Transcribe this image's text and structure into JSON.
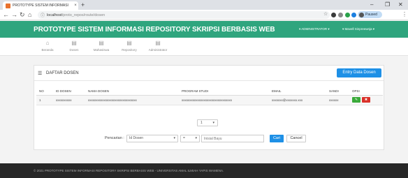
{
  "browser": {
    "tab_title": "PROTOTYPE SISTEM INFORMASI",
    "tab_close": "×",
    "new_tab": "+",
    "url_host": "localhost",
    "url_path": "/proto_repos/route/dosen",
    "profile_label": "Paused",
    "win_min": "–",
    "win_max": "❐",
    "win_close": "✕"
  },
  "header": {
    "title": "PROTOTYPE SISTEM INFORMASI REPOSITORY SKRIPSI BERBASIS WEB",
    "role": "ADMINISTRATOR",
    "user": "Mavell Sinpreewnja"
  },
  "menu": {
    "items": [
      {
        "label": "Beranda",
        "icon": "home-icon"
      },
      {
        "label": "Dosen",
        "icon": "list-icon"
      },
      {
        "label": "Mahasiswa",
        "icon": "list-icon"
      },
      {
        "label": "Repository",
        "icon": "list-icon"
      },
      {
        "label": "Administrator",
        "icon": "list-icon"
      }
    ]
  },
  "panel": {
    "title": "DAFTAR DOSEN",
    "entry_button": "Entry Data Dosen"
  },
  "table": {
    "columns": [
      "NO",
      "ID DOSEN",
      "NAMA DOSEN",
      "PROGRAM STUDI",
      "EMAIL",
      "SANDI",
      "OPSI"
    ],
    "rows": [
      [
        "1",
        "xxxxxxxxxx",
        "xxxxxxxxxxxxxxxxxxxxxxxxxxxxxxx",
        "xxxxxxxxxxxxxxxxxxxxxxxxxxxxxxxx",
        "xxxxxxx@xxxxxxx.xxx",
        "xxxxxx",
        ""
      ]
    ]
  },
  "pagination": {
    "page_value": "1"
  },
  "search": {
    "label": "Pencarian",
    "field_value": "Id Dosen",
    "operator_value": "=",
    "input_placeholder": "Inisial Bayu",
    "search_button": "Cari",
    "cancel_button": "Cancel"
  },
  "footer": {
    "text": "© 2021 PROTOTYPE SISTEM INFORMASI REPOSITORY SKRIPSI BERBASIS WEB - UNIVERSITAS AMAL ILMIAH YAPIS WAMENA."
  },
  "colors": {
    "header_green": "#2fa57e",
    "primary_blue": "#1e90e6",
    "edit_green": "#3aaa3a",
    "delete_red": "#d9312a",
    "footer_dark": "#272727"
  }
}
